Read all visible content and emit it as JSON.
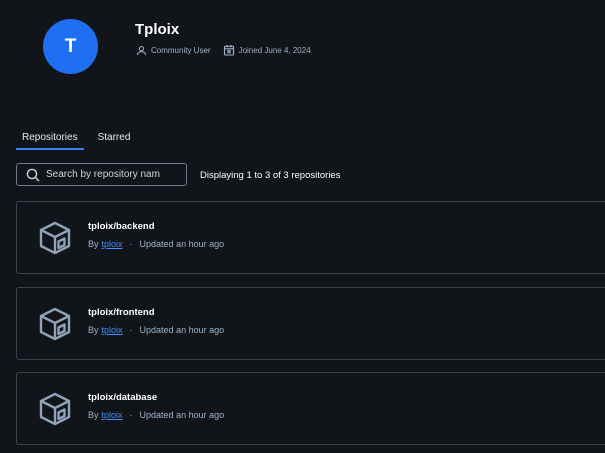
{
  "profile": {
    "avatar_initial": "T",
    "avatar_color": "#1f6ff2",
    "username": "Tploix",
    "role": "Community User",
    "joined": "Joined June 4, 2024"
  },
  "tabs": [
    {
      "label": "Repositories",
      "active": true
    },
    {
      "label": "Starred",
      "active": false
    }
  ],
  "search": {
    "placeholder": "Search by repository nam",
    "value": ""
  },
  "count_text": "Displaying 1 to 3 of 3 repositories",
  "repositories": [
    {
      "name": "tploix/backend",
      "by_label": "By",
      "owner": "tploix",
      "separator": "·",
      "updated": "Updated an hour ago"
    },
    {
      "name": "tploix/frontend",
      "by_label": "By",
      "owner": "tploix",
      "separator": "·",
      "updated": "Updated an hour ago"
    },
    {
      "name": "tploix/database",
      "by_label": "By",
      "owner": "tploix",
      "separator": "·",
      "updated": "Updated an hour ago"
    }
  ],
  "icons": {
    "user": "user-icon",
    "calendar": "calendar-icon",
    "search": "search-icon",
    "repository": "cube-icon"
  },
  "colors": {
    "background": "#111419",
    "accent": "#1f6ff2",
    "link": "#4a8ef7",
    "muted_text": "#9fb3c8",
    "card_border": "#3a4250"
  }
}
